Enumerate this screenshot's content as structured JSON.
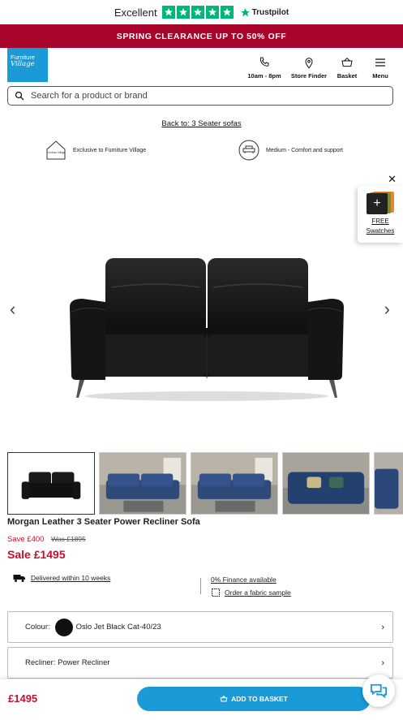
{
  "trustbar": {
    "rating_text": "Excellent",
    "brand": "Trustpilot",
    "stars": 5
  },
  "promo": {
    "text": "SPRING CLEARANCE UP TO 50% OFF"
  },
  "header": {
    "logo_line1": "Furniture",
    "logo_line2": "Village",
    "nav": [
      {
        "label": "10am - 8pm",
        "icon": "phone-icon"
      },
      {
        "label": "Store Finder",
        "icon": "location-pin-icon"
      },
      {
        "label": "Basket",
        "icon": "basket-icon"
      },
      {
        "label": "Menu",
        "icon": "hamburger-icon"
      }
    ]
  },
  "search": {
    "placeholder": "Search for a product or brand"
  },
  "back_link": "Back to: 3 Seater sofas",
  "features": [
    {
      "text": "Exclusive to Furniture Village",
      "icon": "house-icon",
      "icon_text": "Furniture Village"
    },
    {
      "text": "Medium - Comfort and support",
      "icon": "seat-comfort-icon"
    }
  ],
  "swatches": {
    "line1": "FREE",
    "line2": "Swatches"
  },
  "gallery": {
    "prev": "‹",
    "next": "›",
    "thumb_count": 5
  },
  "product": {
    "title": "Morgan Leather 3 Seater Power Recliner Sofa",
    "save": "Save £400",
    "was": "Was £1895",
    "sale": "Sale £1495"
  },
  "delivery": {
    "text": "Delivered within 10 weeks"
  },
  "finance": {
    "text": "0% Finance available"
  },
  "fabric_sample": {
    "text": "Order a fabric sample"
  },
  "options": {
    "colour_label": "Colour:",
    "colour_value": "Oslo Jet Black Cat-40/23",
    "recliner": "Recliner: Power Recliner"
  },
  "bottom_bar": {
    "price": "£1495",
    "button": "ADD TO BASKET"
  },
  "colors": {
    "brand_blue": "#1a9ad6",
    "promo_red": "#a8052c",
    "sale_red": "#c8102e",
    "trustpilot_green": "#00b67a"
  }
}
